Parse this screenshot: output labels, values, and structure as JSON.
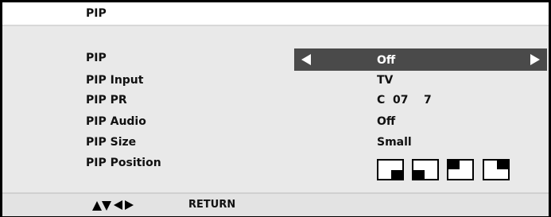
{
  "title": "PIP",
  "menu": {
    "items": [
      {
        "label": "PIP",
        "value": "Off"
      },
      {
        "label": "PIP Input",
        "value": "TV"
      },
      {
        "label": "PIP PR",
        "value": "C  07    7"
      },
      {
        "label": "PIP Audio",
        "value": "Off"
      },
      {
        "label": "PIP Size",
        "value": "Small"
      },
      {
        "label": "PIP Position",
        "value": ""
      }
    ],
    "selected_index": 0
  },
  "position_options": [
    {
      "name": "bottom-right"
    },
    {
      "name": "bottom-left"
    },
    {
      "name": "top-left"
    },
    {
      "name": "top-right"
    }
  ],
  "footer": {
    "nav_icon": "up-down-left-right-arrows",
    "return_label": "RETURN"
  },
  "colors": {
    "selection": "#4a4a4a",
    "background": "#e9e9e9",
    "frame": "#000000"
  }
}
